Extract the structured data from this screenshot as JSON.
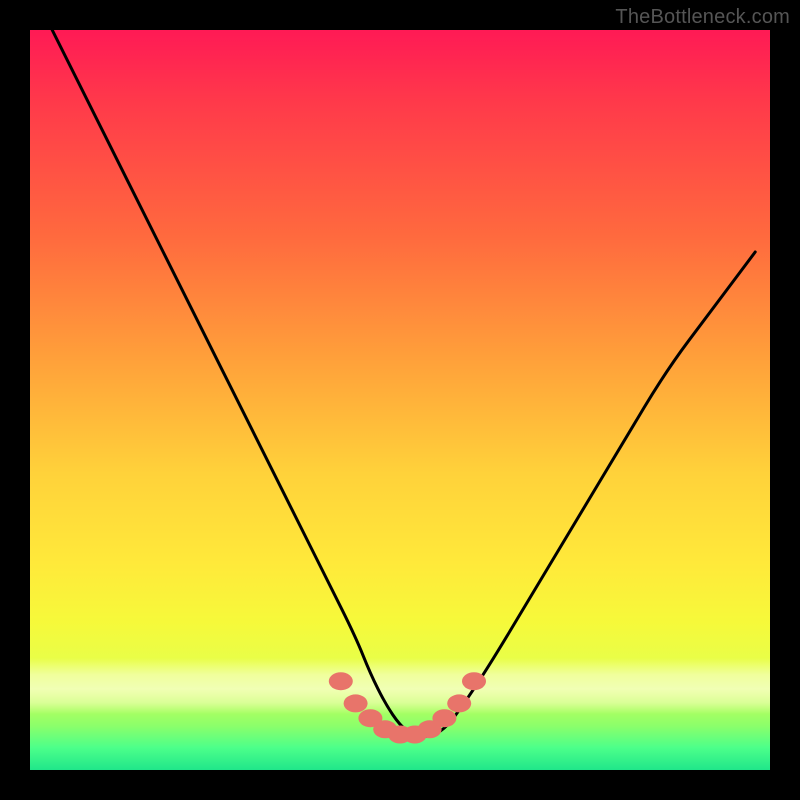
{
  "watermark": "TheBottleneck.com",
  "chart_data": {
    "type": "line",
    "title": "",
    "xlabel": "",
    "ylabel": "",
    "xlim": [
      0,
      100
    ],
    "ylim": [
      0,
      100
    ],
    "grid": false,
    "legend": false,
    "series": [
      {
        "name": "bottleneck-curve",
        "x": [
          3,
          8,
          12,
          16,
          20,
          24,
          28,
          32,
          36,
          40,
          44,
          46,
          48,
          50,
          52,
          54,
          56,
          58,
          62,
          68,
          74,
          80,
          86,
          92,
          98
        ],
        "values": [
          100,
          90,
          82,
          74,
          66,
          58,
          50,
          42,
          34,
          26,
          18,
          13,
          9,
          6,
          4.5,
          4.5,
          5.5,
          8,
          14,
          24,
          34,
          44,
          54,
          62,
          70
        ]
      }
    ],
    "markers": {
      "name": "highlight-dots",
      "color": "#e8746a",
      "x": [
        42,
        44,
        46,
        48,
        50,
        52,
        54,
        56,
        58,
        60
      ],
      "values": [
        12,
        9,
        7,
        5.5,
        4.8,
        4.8,
        5.5,
        7,
        9,
        12
      ]
    },
    "annotations": []
  }
}
